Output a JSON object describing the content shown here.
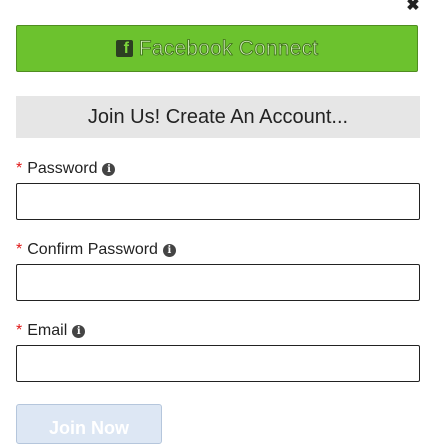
{
  "dialog": {
    "close_glyph": "✖",
    "facebook_button": {
      "icon": "facebook-logo",
      "label": "Facebook Connect"
    },
    "banner_title": "Join Us! Create An Account...",
    "fields": [
      {
        "label": "Password",
        "required_marker": "*",
        "info_glyph": "i",
        "value": ""
      },
      {
        "label": "Confirm Password",
        "required_marker": "*",
        "info_glyph": "i",
        "value": ""
      },
      {
        "label": "Email",
        "required_marker": "*",
        "info_glyph": "i",
        "value": ""
      }
    ],
    "submit_label": "Join Now"
  },
  "colors": {
    "facebook_button_bg": "#6cc22e",
    "banner_bg": "#e6e6e6",
    "required_marker": "#e01818",
    "submit_bg": "#dde7f4"
  }
}
